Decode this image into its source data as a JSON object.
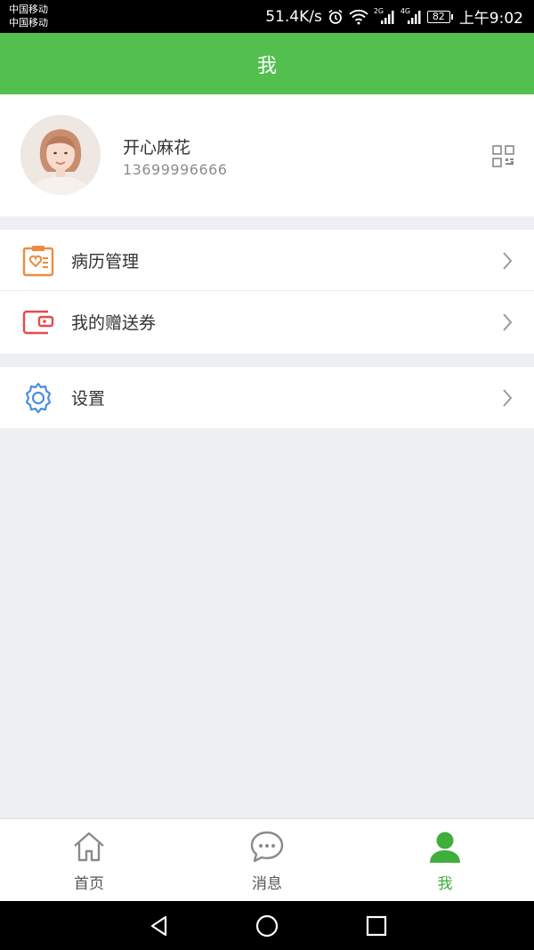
{
  "status_bar": {
    "carrier_1": "中国移动",
    "carrier_2": "中国移动",
    "net_speed": "51.4K/s",
    "network_2g": "2G",
    "network_4g": "4G",
    "battery": "82",
    "time": "上午9:02"
  },
  "header": {
    "title": "我"
  },
  "profile": {
    "nickname": "开心麻花",
    "phone": "13699996666",
    "avatar_icon": "user-avatar-photo",
    "qrcode_icon": "qrcode-icon"
  },
  "menu": {
    "items": [
      {
        "label": "病历管理",
        "icon": "medical-record-icon",
        "color": "#f08a3c"
      },
      {
        "label": "我的赠送券",
        "icon": "wallet-coupon-icon",
        "color": "#e84a4a"
      },
      {
        "label": "设置",
        "icon": "gear-icon",
        "color": "#4a8de0"
      }
    ]
  },
  "tabbar": {
    "tabs": [
      {
        "label": "首页",
        "icon": "home-icon",
        "active": false
      },
      {
        "label": "消息",
        "icon": "chat-bubble-icon",
        "active": false
      },
      {
        "label": "我",
        "icon": "person-icon",
        "active": true
      }
    ],
    "active_color": "#3fae3c"
  },
  "colors": {
    "header_green": "#52bf4f",
    "page_bg": "#eeeff3"
  }
}
